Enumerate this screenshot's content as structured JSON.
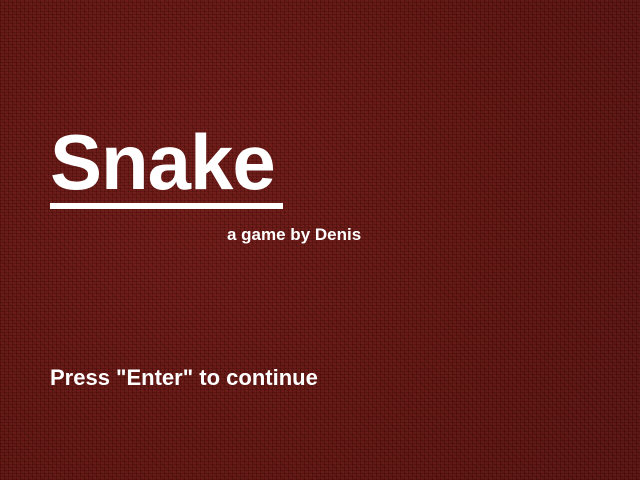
{
  "screen": {
    "title": "Snake",
    "byline": "a game by Denis",
    "prompt": "Press \"Enter\" to continue"
  },
  "colors": {
    "background": "#5e0f0b",
    "text": "#ffffff"
  }
}
